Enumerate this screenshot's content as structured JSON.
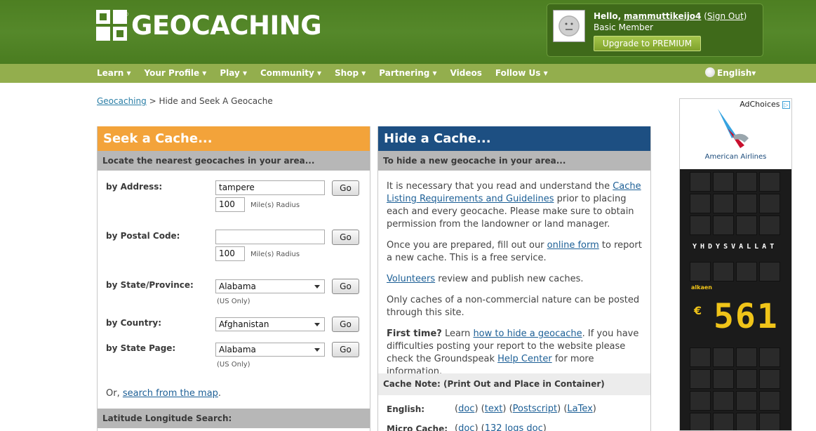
{
  "brand": {
    "name": "GEOCACHING",
    "registered": "®"
  },
  "user": {
    "hello": "Hello,",
    "name": "mammuttikeijo4",
    "sign_out": "Sign Out",
    "level": "Basic Member",
    "upgrade_label": "Upgrade to PREMIUM"
  },
  "nav": {
    "items": [
      "Learn ▾",
      "Your Profile ▾",
      "Play ▾",
      "Community ▾",
      "Shop ▾",
      "Partnering ▾",
      "Videos",
      "Follow Us ▾"
    ],
    "language": "English▾"
  },
  "breadcrumb": {
    "root": "Geocaching",
    "sep": ">",
    "current": "Hide and Seek A Geocache"
  },
  "seek": {
    "title": "Seek a Cache...",
    "subtitle": "Locate the nearest geocaches in your area...",
    "by_address": {
      "label": "by Address:",
      "value": "tampere",
      "radius": "100",
      "radius_label": "Mile(s) Radius"
    },
    "by_postal": {
      "label": "by Postal Code:",
      "value": "",
      "radius": "100",
      "radius_label": "Mile(s) Radius"
    },
    "by_state": {
      "label": "by State/Province:",
      "selected": "Alabama",
      "note": "(US Only)"
    },
    "by_country": {
      "label": "by Country:",
      "selected": "Afghanistan"
    },
    "by_state_page": {
      "label": "by State Page:",
      "selected": "Alabama",
      "note": "(US Only)"
    },
    "go_label": "Go",
    "or_prefix": "Or,",
    "map_link": "search from the map",
    "map_suffix": ".",
    "latlon_title": "Latitude Longitude Search:"
  },
  "hide": {
    "title": "Hide a Cache...",
    "subtitle": "To hide a new geocache in your area...",
    "p1_a": "It is necessary that you read and understand the",
    "p1_link": "Cache Listing Requirements and Guidelines",
    "p1_b": "prior to placing each and every geocache. Please make sure to obtain permission from the landowner or land manager.",
    "p2_a": "Once you are prepared, fill out our",
    "p2_link": "online form",
    "p2_b": "to report a new cache. This is a free service.",
    "p3_link": "Volunteers",
    "p3_b": "review and publish new caches.",
    "p4": "Only caches of a non-commercial nature can be posted through this site.",
    "p5_bold": "First time?",
    "p5_a": "Learn",
    "p5_link": "how to hide a geocache",
    "p5_b": ". If you have difficulties posting your report to the website please check the Groundspeak",
    "p5_link2": "Help Center",
    "p5_c": "for more information.",
    "note_title": "Cache Note: (Print Out and Place in Container)",
    "english_label": "English:",
    "english_links": [
      "doc",
      "text",
      "Postscript",
      "LaTex"
    ],
    "micro_label": "Micro Cache:",
    "micro_links": [
      "doc",
      "132 logs doc"
    ]
  },
  "ad": {
    "adchoices": "AdChoices",
    "brand": "American Airlines",
    "board_text": "YHDYSVALLAT",
    "alkaen": "alkaen",
    "currency": "€",
    "price": "561"
  }
}
